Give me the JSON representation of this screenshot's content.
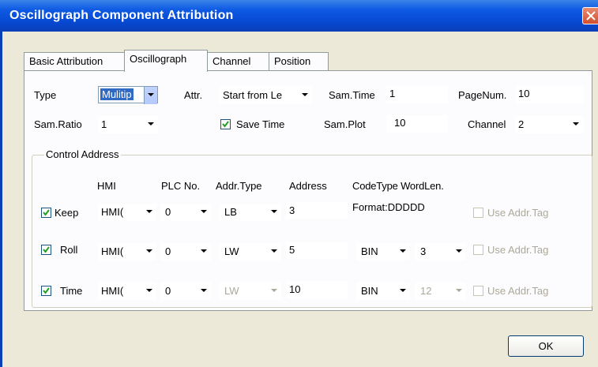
{
  "window": {
    "title": "Oscillograph Component Attribution",
    "ok_label": "OK"
  },
  "tabs": [
    "Basic Attribution",
    "Oscillograph",
    "Channel",
    "Position"
  ],
  "active_tab": "Oscillograph",
  "row1": {
    "type_label": "Type",
    "type_value": "Mulitip",
    "attr_label": "Attr.",
    "attr_value": "Start from Le",
    "samtime_label": "Sam.Time",
    "samtime_value": "1",
    "pagenum_label": "PageNum.",
    "pagenum_value": "10"
  },
  "row2": {
    "samratio_label": "Sam.Ratio",
    "samratio_value": "1",
    "savetime_label": "Save Time",
    "savetime_checked": true,
    "samplot_label": "Sam.Plot",
    "samplot_value": "10",
    "channel_label": "Channel",
    "channel_value": "2"
  },
  "control": {
    "title": "Control Address",
    "headers": {
      "hmi": "HMI",
      "plc": "PLC No.",
      "addrtype": "Addr.Type",
      "address": "Address",
      "codetype": "CodeType WordLen."
    },
    "format_text": "Format:DDDDD",
    "use_tag_label": "Use Addr.Tag",
    "rows": [
      {
        "label": "Keep",
        "checked": true,
        "hmi": "HMI(",
        "plc": "0",
        "addrtype": "LB",
        "address": "3"
      },
      {
        "label": "Roll",
        "checked": true,
        "hmi": "HMI(",
        "plc": "0",
        "addrtype": "LW",
        "address": "5",
        "codetype": "BIN",
        "wordlen": "3"
      },
      {
        "label": "Time",
        "checked": true,
        "hmi": "HMI(",
        "plc": "0",
        "addrtype": "LW",
        "address": "10",
        "codetype": "BIN",
        "wordlen": "12"
      }
    ]
  }
}
